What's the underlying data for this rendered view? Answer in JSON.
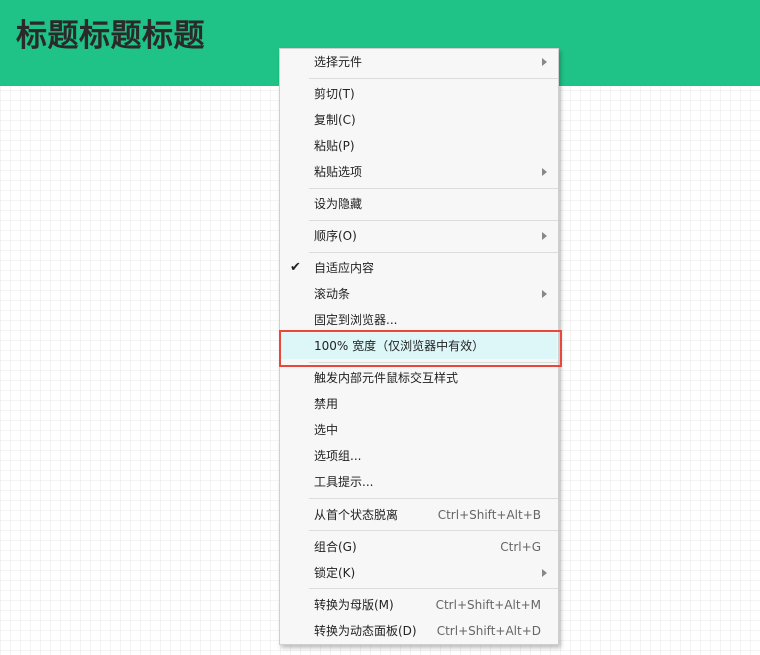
{
  "page": {
    "title": "标题标题标题"
  },
  "colors": {
    "header_bg": "#20c387",
    "menu_bg": "#f7f7f7",
    "highlight_row": "#ddf7f9",
    "highlight_border": "#e8483a"
  },
  "context_menu": {
    "items": [
      {
        "label": "选择元件",
        "shortcut": "",
        "submenu": true,
        "checked": false
      },
      {
        "label": "剪切(T)",
        "shortcut": "",
        "submenu": false,
        "checked": false
      },
      {
        "label": "复制(C)",
        "shortcut": "",
        "submenu": false,
        "checked": false
      },
      {
        "label": "粘贴(P)",
        "shortcut": "",
        "submenu": false,
        "checked": false
      },
      {
        "label": "粘贴选项",
        "shortcut": "",
        "submenu": true,
        "checked": false
      },
      {
        "label": "设为隐藏",
        "shortcut": "",
        "submenu": false,
        "checked": false
      },
      {
        "label": "顺序(O)",
        "shortcut": "",
        "submenu": true,
        "checked": false
      },
      {
        "label": "自适应内容",
        "shortcut": "",
        "submenu": false,
        "checked": true,
        "check_icon": "checkmark-icon"
      },
      {
        "label": "滚动条",
        "shortcut": "",
        "submenu": true,
        "checked": false
      },
      {
        "label": "固定到浏览器...",
        "shortcut": "",
        "submenu": false,
        "checked": false
      },
      {
        "label": "100% 宽度（仅浏览器中有效）",
        "shortcut": "",
        "submenu": false,
        "checked": false,
        "highlighted": true
      },
      {
        "label": "触发内部元件鼠标交互样式",
        "shortcut": "",
        "submenu": false,
        "checked": false
      },
      {
        "label": "禁用",
        "shortcut": "",
        "submenu": false,
        "checked": false
      },
      {
        "label": "选中",
        "shortcut": "",
        "submenu": false,
        "checked": false
      },
      {
        "label": "选项组...",
        "shortcut": "",
        "submenu": false,
        "checked": false
      },
      {
        "label": "工具提示...",
        "shortcut": "",
        "submenu": false,
        "checked": false
      },
      {
        "label": "从首个状态脱离",
        "shortcut": "Ctrl+Shift+Alt+B",
        "submenu": false,
        "checked": false
      },
      {
        "label": "组合(G)",
        "shortcut": "Ctrl+G",
        "submenu": false,
        "checked": false
      },
      {
        "label": "锁定(K)",
        "shortcut": "",
        "submenu": true,
        "checked": false
      },
      {
        "label": "转换为母版(M)",
        "shortcut": "Ctrl+Shift+Alt+M",
        "submenu": false,
        "checked": false
      },
      {
        "label": "转换为动态面板(D)",
        "shortcut": "Ctrl+Shift+Alt+D",
        "submenu": false,
        "checked": false
      }
    ]
  }
}
